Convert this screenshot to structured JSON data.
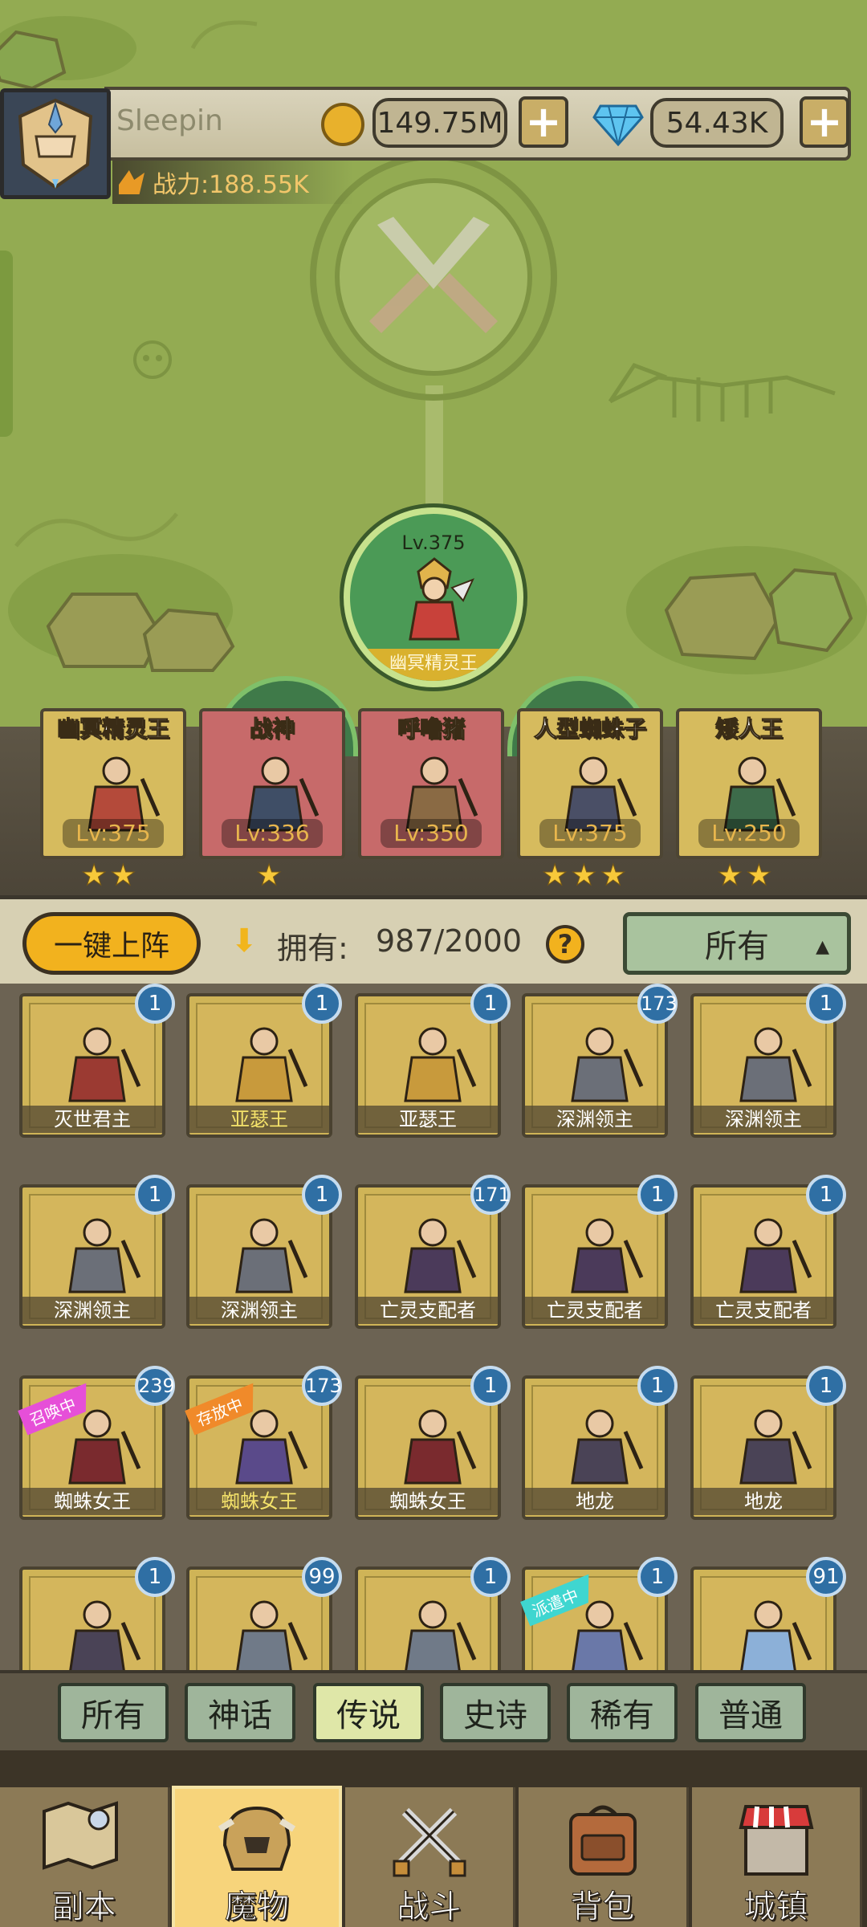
{
  "player": {
    "name": "Sleepin",
    "power": "战力:188.55K"
  },
  "resources": {
    "gold": "149.75M",
    "gems": "54.43K",
    "plus": "+"
  },
  "center_hero": {
    "level": "Lv.375",
    "name": "幽冥精灵王"
  },
  "lineup": [
    {
      "name": "幽冥精灵王",
      "level": "Lv:375",
      "stars": 2,
      "color": "#d6bb5e"
    },
    {
      "name": "战神",
      "level": "Lv:336",
      "stars": 1,
      "color": "#c76a6a"
    },
    {
      "name": "呼噜猪",
      "level": "Lv:350",
      "stars": 0,
      "color": "#c76a6a"
    },
    {
      "name": "人型蜘蛛子",
      "level": "Lv:375",
      "stars": 3,
      "color": "#d6bb5e"
    },
    {
      "name": "矮人王",
      "level": "Lv:250",
      "stars": 2,
      "color": "#d6bb5e"
    }
  ],
  "toolbar": {
    "deploy": "一键上阵",
    "own_label": "拥有:",
    "own_count": "987/2000",
    "help": "?",
    "filter": "所有"
  },
  "monsters": [
    {
      "name": "灭世君主",
      "count": "1",
      "highlight": false
    },
    {
      "name": "亚瑟王",
      "count": "1",
      "highlight": true
    },
    {
      "name": "亚瑟王",
      "count": "1",
      "highlight": false
    },
    {
      "name": "深渊领主",
      "count": "173",
      "highlight": false
    },
    {
      "name": "深渊领主",
      "count": "1",
      "highlight": false
    },
    {
      "name": "深渊领主",
      "count": "1",
      "highlight": false
    },
    {
      "name": "深渊领主",
      "count": "1",
      "highlight": false
    },
    {
      "name": "亡灵支配者",
      "count": "171",
      "highlight": false
    },
    {
      "name": "亡灵支配者",
      "count": "1",
      "highlight": false
    },
    {
      "name": "亡灵支配者",
      "count": "1",
      "highlight": false
    },
    {
      "name": "蜘蛛女王",
      "count": "239",
      "highlight": false,
      "tag": "召唤中",
      "tag_color": "#e64fd8"
    },
    {
      "name": "蜘蛛女王",
      "count": "173",
      "highlight": true,
      "tag": "存放中",
      "tag_color": "#f08a2a"
    },
    {
      "name": "蜘蛛女王",
      "count": "1",
      "highlight": false
    },
    {
      "name": "地龙",
      "count": "1",
      "highlight": false
    },
    {
      "name": "地龙",
      "count": "1",
      "highlight": false
    },
    {
      "name": "",
      "count": "1",
      "highlight": false
    },
    {
      "name": "",
      "count": "99",
      "highlight": false
    },
    {
      "name": "",
      "count": "1",
      "highlight": false
    },
    {
      "name": "",
      "count": "1",
      "highlight": false,
      "tag": "派遣中",
      "tag_color": "#3fd6d0"
    },
    {
      "name": "",
      "count": "91",
      "highlight": false
    }
  ],
  "rarity_tabs": [
    {
      "label": "所有",
      "active": false
    },
    {
      "label": "神话",
      "active": false
    },
    {
      "label": "传说",
      "active": true
    },
    {
      "label": "史诗",
      "active": false
    },
    {
      "label": "稀有",
      "active": false
    },
    {
      "label": "普通",
      "active": false
    }
  ],
  "nav": [
    {
      "label": "副本",
      "icon": "map-icon",
      "active": false
    },
    {
      "label": "魔物",
      "icon": "helmet-icon",
      "active": true
    },
    {
      "label": "战斗",
      "icon": "crossed-swords-icon",
      "active": false
    },
    {
      "label": "背包",
      "icon": "backpack-icon",
      "active": false
    },
    {
      "label": "城镇",
      "icon": "shop-icon",
      "active": false
    }
  ]
}
